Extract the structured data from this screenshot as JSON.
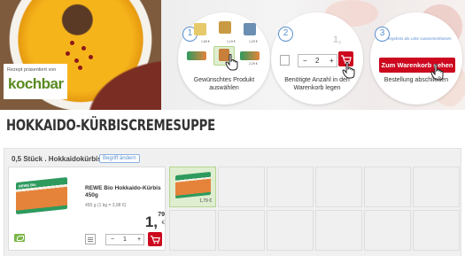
{
  "hero": {
    "presenter_caption": "Rezept präsentiert von",
    "presenter_logo": "kochbar"
  },
  "steps": [
    {
      "number": "1",
      "label": "Gewünschtes Produkt auswählen",
      "mini_prices": [
        "1,59 €",
        "1,19 €",
        "1,29 €",
        "2,29 €"
      ]
    },
    {
      "number": "2",
      "label": "Benötigte Anzahl in den Warenkorb legen",
      "qty_minus": "−",
      "qty_value": "2",
      "qty_plus": "+",
      "ghost_price": "1,"
    },
    {
      "number": "3",
      "label": "Bestellung abschließen",
      "hint": "ergebnis als Liste zusammenfassen",
      "button": "Zum Warenkorb gehen"
    }
  ],
  "recipe": {
    "title": "HOKKAIDO-KÜRBISCREMESUPPE"
  },
  "ingredient": {
    "heading": "0,5 Stück . Hokkaidokürbis",
    "change_label": "Begriff ändern",
    "product": {
      "name": "REWE Bio Hokkaido-Kürbis 450g",
      "unit_price": "450 g (1 kg = 3,98 €)",
      "price_main": "1,",
      "price_cents": "79",
      "currency": "€",
      "qty_minus": "−",
      "qty_value": "1",
      "qty_plus": "+",
      "image_label": "REWE Bio"
    },
    "alternatives": [
      {
        "price": "1,79 €",
        "selected": true
      }
    ]
  },
  "colors": {
    "accent_red": "#cc071e",
    "step_blue": "#5b8fd0",
    "bio_green": "#7ab648",
    "kochbar_green": "#5a8a1f"
  },
  "icons": [
    "shopping-cart-icon",
    "shopping-list-icon",
    "hand-cursor-icon",
    "bio-leaf-icon"
  ]
}
